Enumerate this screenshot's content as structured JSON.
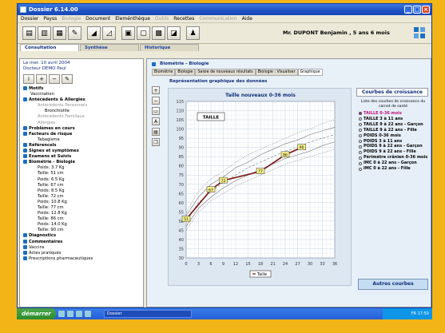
{
  "window": {
    "title": "Dossier 6.14.00",
    "buttons": [
      "_",
      "□",
      "×"
    ]
  },
  "menu": {
    "items": [
      {
        "label": "Dossier",
        "enabled": true
      },
      {
        "label": "Payss",
        "enabled": true
      },
      {
        "label": "Biologie",
        "enabled": false
      },
      {
        "label": "Document",
        "enabled": true
      },
      {
        "label": "Eleménthèque",
        "enabled": true
      },
      {
        "label": "Outils",
        "enabled": false
      },
      {
        "label": "Recettes",
        "enabled": true
      },
      {
        "label": "Communication",
        "enabled": false
      },
      {
        "label": "Aide",
        "enabled": true
      }
    ]
  },
  "toolbar": {
    "patient": "Mr. DUPONT Benjamin , 5 ans 6 mois",
    "buttons": [
      "1",
      "2",
      "3",
      "4",
      "5",
      "6",
      "7",
      "8",
      "9",
      "10",
      "11"
    ]
  },
  "main_tabs": [
    "Consultation",
    "Synthèse",
    "Historique"
  ],
  "left": {
    "date": "Le mer. 10 avril 2004",
    "doctor": "Docteur DEMO Paul",
    "tree": [
      {
        "label": "Motifs",
        "bold": true,
        "level": 0
      },
      {
        "label": "Vaccination",
        "bold": false,
        "level": 1
      },
      {
        "label": "Antécédents & Allergies",
        "bold": true,
        "level": 0
      },
      {
        "label": "Antécédents Personnels",
        "bold": false,
        "level": 2,
        "grey": true
      },
      {
        "label": "Bronchiolite",
        "bold": false,
        "level": 3
      },
      {
        "label": "Antécédents Familiaux",
        "bold": false,
        "level": 2,
        "grey": true
      },
      {
        "label": "Allergies",
        "bold": false,
        "level": 2,
        "grey": true
      },
      {
        "label": "Problèmes en cours",
        "bold": true,
        "level": 0
      },
      {
        "label": "Facteurs de risque",
        "bold": true,
        "level": 0
      },
      {
        "label": "Tabagisme",
        "bold": false,
        "level": 2
      },
      {
        "label": "Référencels",
        "bold": true,
        "level": 0
      },
      {
        "label": "Signes et symptômes",
        "bold": true,
        "level": 0
      },
      {
        "label": "Examens et Suivis",
        "bold": true,
        "level": 0
      },
      {
        "label": "Biométrie - Biologie",
        "bold": true,
        "level": 0
      },
      {
        "label": "Poids: 3.7 Kg",
        "bold": false,
        "level": 2
      },
      {
        "label": "Taille: 51 cm",
        "bold": false,
        "level": 2
      },
      {
        "label": "Poids: 6.5 Kg",
        "bold": false,
        "level": 2
      },
      {
        "label": "Taille: 67 cm",
        "bold": false,
        "level": 2
      },
      {
        "label": "Poids: 8.5 Kg",
        "bold": false,
        "level": 2
      },
      {
        "label": "Taille: 72 cm",
        "bold": false,
        "level": 2
      },
      {
        "label": "Poids: 10.8 Kg",
        "bold": false,
        "level": 2
      },
      {
        "label": "Taille: 77 cm",
        "bold": false,
        "level": 2
      },
      {
        "label": "Poids: 12.8 Kg",
        "bold": false,
        "level": 2
      },
      {
        "label": "Taille: 86 cm",
        "bold": false,
        "level": 2
      },
      {
        "label": "Poids: 14.0 Kg",
        "bold": false,
        "level": 2
      },
      {
        "label": "Taille: 90 cm",
        "bold": false,
        "level": 2
      },
      {
        "label": "Diagnostics",
        "bold": true,
        "level": 0
      },
      {
        "label": "Commentaires",
        "bold": true,
        "level": 0
      },
      {
        "label": "Vaccins",
        "bold": false,
        "level": 0
      },
      {
        "label": "Actes pratiqués",
        "bold": false,
        "level": 0
      },
      {
        "label": "Prescriptions pharmaceutiques",
        "bold": false,
        "level": 0
      }
    ]
  },
  "right": {
    "title": "Biométrie - Biologie",
    "subtabs": [
      "Biométrie",
      "Biologie",
      "Saisie de nouveaux résultats",
      "Biologie : Visualiser",
      "Graphique"
    ],
    "active_subtab": 4,
    "report_title": "Représentation graphique des données"
  },
  "side": {
    "title": "Courbes de croissance",
    "note": "Liste des courbes de croissance du carnet de santé",
    "options": [
      {
        "label": "TAILLE 0-36 mois",
        "selected": true
      },
      {
        "label": "TAILLE 3 à 11 ans",
        "selected": false
      },
      {
        "label": "TAILLE 9 à 22 ans - Garçon",
        "selected": false
      },
      {
        "label": "TAILLE 9 à 22 ans - Fille",
        "selected": false
      },
      {
        "label": "POIDS 0-36 mois",
        "selected": false
      },
      {
        "label": "POIDS 3 à 11 ans",
        "selected": false
      },
      {
        "label": "POIDS 9 à 22 ans - Garçon",
        "selected": false
      },
      {
        "label": "POIDS 9 à 22 ans - Fille",
        "selected": false
      },
      {
        "label": "Périmètre crânien 0-36 mois",
        "selected": false
      },
      {
        "label": "IMC 0 à 22 ans - Garçon",
        "selected": false
      },
      {
        "label": "IMC 0 à 22 ans - Fille",
        "selected": false
      }
    ],
    "button": "Autres courbes"
  },
  "chart_data": {
    "type": "line",
    "title": "Taille nouveaux 0-36 mois",
    "label_box": "TAILLE",
    "legend": "Taille",
    "xlim": [
      0,
      36
    ],
    "ylim": [
      30,
      115
    ],
    "xticks": [
      0,
      3,
      6,
      9,
      12,
      15,
      18,
      21,
      24,
      27,
      30,
      33,
      36
    ],
    "yticks": [
      30,
      35,
      40,
      45,
      50,
      55,
      60,
      65,
      70,
      75,
      80,
      85,
      90,
      95,
      100,
      105,
      110,
      115
    ],
    "grid": true,
    "series": [
      {
        "name": "Taille",
        "x": [
          0,
          6,
          9,
          18,
          24,
          28
        ],
        "y": [
          51,
          67,
          72,
          77,
          86,
          90
        ]
      }
    ],
    "reference_curves": [
      {
        "style": "dotted",
        "x": [
          0,
          3,
          6,
          9,
          12,
          15,
          18,
          21,
          24,
          27,
          30,
          33,
          36
        ],
        "y": [
          45,
          55,
          61,
          65,
          69,
          72,
          75,
          78,
          81,
          83,
          85,
          87,
          89
        ]
      },
      {
        "style": "solid",
        "x": [
          0,
          3,
          6,
          9,
          12,
          15,
          18,
          21,
          24,
          27,
          30,
          33,
          36
        ],
        "y": [
          47,
          57,
          63,
          68,
          72,
          75,
          78,
          81,
          84,
          86,
          88,
          91,
          93
        ]
      },
      {
        "style": "dashed",
        "x": [
          0,
          3,
          6,
          9,
          12,
          15,
          18,
          21,
          24,
          27,
          30,
          33,
          36
        ],
        "y": [
          50,
          60,
          66,
          71,
          75,
          79,
          82,
          85,
          88,
          90,
          93,
          95,
          97
        ]
      },
      {
        "style": "solid",
        "x": [
          0,
          3,
          6,
          9,
          12,
          15,
          18,
          21,
          24,
          27,
          30,
          33,
          36
        ],
        "y": [
          53,
          63,
          70,
          74,
          79,
          82,
          86,
          89,
          92,
          94,
          97,
          99,
          101
        ]
      },
      {
        "style": "dotted",
        "x": [
          0,
          3,
          6,
          9,
          12,
          15,
          18,
          21,
          24,
          27,
          30,
          33,
          36
        ],
        "y": [
          55,
          66,
          73,
          77,
          82,
          86,
          89,
          92,
          95,
          98,
          100,
          103,
          105
        ]
      }
    ]
  },
  "taskbar": {
    "start": "démarrer",
    "task": "Dossier",
    "tray": "FR  17:50"
  }
}
